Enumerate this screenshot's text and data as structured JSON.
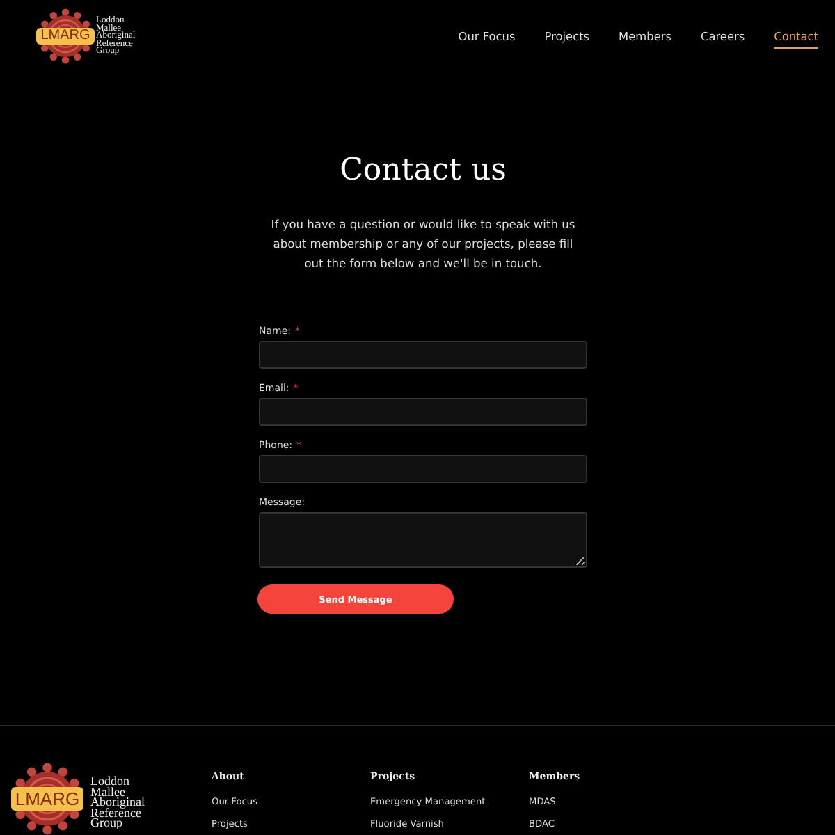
{
  "header": {
    "logo": {
      "mark": "LMARG",
      "name": "Loddon Mallee Aboriginal Reference Group"
    },
    "nav": [
      {
        "label": "Our Focus",
        "selected": false
      },
      {
        "label": "Projects",
        "selected": false
      },
      {
        "label": "Members",
        "selected": false
      },
      {
        "label": "Careers",
        "selected": false
      },
      {
        "label": "Contact",
        "selected": true
      }
    ]
  },
  "contact": {
    "title": "Contact us",
    "intro": "If you have a question or would like to speak with us about membership or any of our projects, please fill out the form below and we'll be in touch.",
    "required_mark": "*",
    "fields": [
      {
        "label": "Name:",
        "kind": "input",
        "required": true
      },
      {
        "label": "Email:",
        "kind": "input",
        "required": true
      },
      {
        "label": "Phone:",
        "kind": "input",
        "required": true
      },
      {
        "label": "Message:",
        "kind": "textarea",
        "required": false
      }
    ],
    "submit": "Send Message"
  },
  "footer": {
    "logo": {
      "mark": "LMARG",
      "name": "Loddon Mallee Aboriginal Reference Group"
    },
    "columns": [
      {
        "heading": "About",
        "links": [
          "Our Focus",
          "Projects"
        ]
      },
      {
        "heading": "Projects",
        "links": [
          "Emergency Management",
          "Fluoride Varnish"
        ]
      },
      {
        "heading": "Members",
        "links": [
          "MDAS",
          "BDAC"
        ]
      }
    ]
  }
}
